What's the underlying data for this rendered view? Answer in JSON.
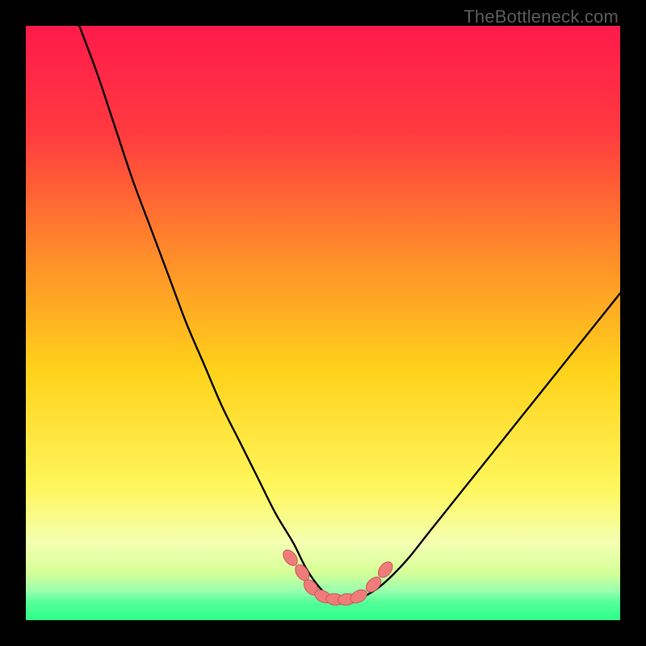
{
  "watermark": "TheBottleneck.com",
  "colors": {
    "frame": "#000000",
    "gradient_top": "#ff1a4b",
    "gradient_upper_mid": "#ff6b2e",
    "gradient_mid": "#ffd21a",
    "gradient_lower_mid": "#fff75e",
    "gradient_low": "#d9ff8a",
    "gradient_bottom": "#2eff88",
    "curve": "#000000",
    "marker_fill": "#ef7c7a",
    "marker_stroke": "#c95a58"
  },
  "chart_data": {
    "type": "line",
    "title": "",
    "xlabel": "",
    "ylabel": "",
    "xlim": [
      0,
      100
    ],
    "ylim": [
      0,
      100
    ],
    "series": [
      {
        "name": "bottleneck-curve",
        "x": [
          9,
          12,
          15,
          18,
          21,
          24,
          27,
          30,
          33,
          36,
          39,
          42,
          45,
          47,
          49,
          51,
          53,
          55,
          57,
          60,
          64,
          68,
          72,
          76,
          80,
          84,
          88,
          92,
          96,
          100
        ],
        "y": [
          100,
          92,
          83,
          74,
          66,
          58,
          50,
          43,
          36,
          30,
          24,
          18,
          13,
          9,
          6,
          4,
          3,
          3,
          4,
          6,
          10,
          15,
          20,
          25,
          30,
          35,
          40,
          45,
          50,
          55
        ]
      }
    ],
    "markers": {
      "name": "highlight-points",
      "x": [
        44.5,
        46.5,
        48,
        50,
        52,
        54,
        56,
        58.5,
        60.5
      ],
      "y": [
        10.5,
        8,
        5.5,
        4,
        3.5,
        3.5,
        4,
        6,
        8.5
      ]
    }
  }
}
